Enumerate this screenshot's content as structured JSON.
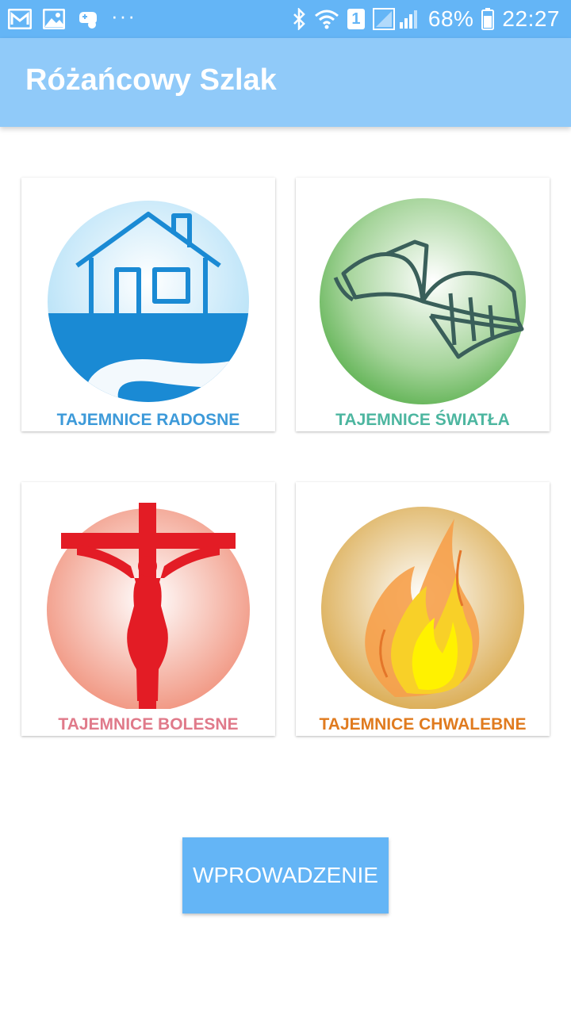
{
  "status_bar": {
    "battery_percent": "68%",
    "time": "22:27",
    "sim_slot": "1",
    "overflow": "···",
    "left_icons": [
      "gmail-icon",
      "gallery-icon",
      "game-controller-icon"
    ],
    "right_icons": [
      "bluetooth-icon",
      "wifi-icon",
      "sim-1-icon",
      "signal-icon",
      "battery-icon"
    ]
  },
  "app_bar": {
    "title": "Różańcowy Szlak"
  },
  "mysteries": [
    {
      "label": "TAJEMNICE RADOSNE",
      "color": "#3d9ad9",
      "icon": "house-icon"
    },
    {
      "label": "TAJEMNICE ŚWIATŁA",
      "color": "#4db6a0",
      "icon": "open-book-icon"
    },
    {
      "label": "TAJEMNICE BOLESNE",
      "color": "#e07a8a",
      "icon": "crucifix-icon"
    },
    {
      "label": "TAJEMNICE CHWALEBNE",
      "color": "#e07b1f",
      "icon": "flame-icon"
    }
  ],
  "intro_button": {
    "label": "WPROWADZENIE"
  },
  "colors": {
    "status_bar": "#64b5f6",
    "app_bar": "#90caf9",
    "button": "#64b5f6"
  }
}
